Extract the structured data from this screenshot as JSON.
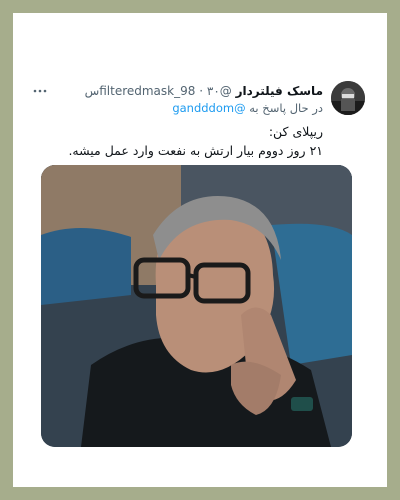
{
  "tweet": {
    "display_name": "ماسک فیلتردار",
    "handle": "@filteredmask_98",
    "separator": "·",
    "time": "۳۰س",
    "more_icon": "more-dots-icon",
    "reply_prefix": "در حال پاسخ به",
    "reply_to": "@gandddom",
    "text_line1": "ریپلای کن:",
    "text_line2": "۲۱ روز دووم بیار ارتش به نفعت وارد عمل میشه.",
    "media_description_icon": "photo"
  },
  "colors": {
    "frame": "#a6ad8c",
    "card": "#ffffff",
    "text": "#0f1419",
    "muted": "#536471",
    "link": "#1d9bf0"
  }
}
